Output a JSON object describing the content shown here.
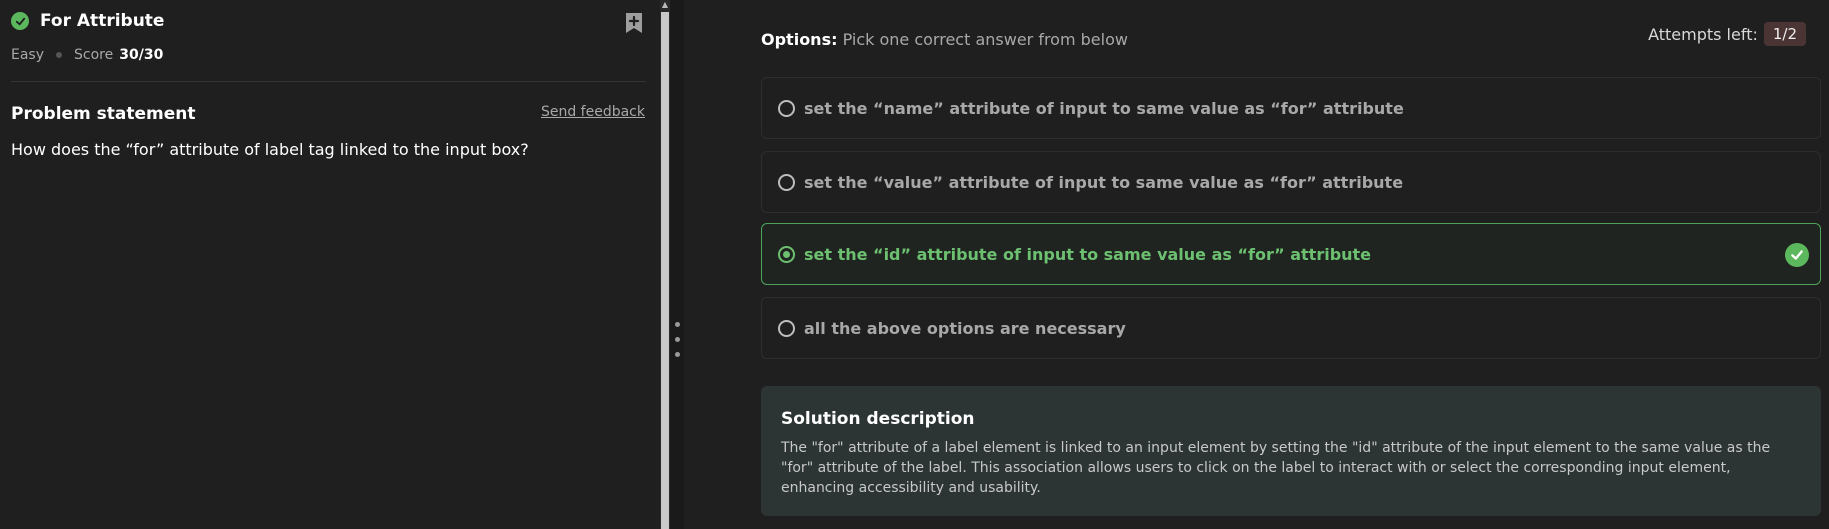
{
  "problem": {
    "title": "For Attribute",
    "difficulty": "Easy",
    "score_label": "Score",
    "score_value": "30/30",
    "statement_heading": "Problem statement",
    "feedback_link": "Send feedback",
    "question": "How does the “for” attribute of label tag linked to the input box?"
  },
  "options_section": {
    "label_bold": "Options:",
    "label_rest": " Pick one correct answer from below",
    "attempts_label": "Attempts left:",
    "attempts_value": "1/2",
    "items": [
      {
        "text": "set the “name” attribute of input to same value as “for” attribute",
        "selected": false,
        "correct": false
      },
      {
        "text": "set the “value” attribute of input to same value as “for” attribute",
        "selected": false,
        "correct": false
      },
      {
        "text": "set the “id” attribute of input to same value as “for” attribute",
        "selected": true,
        "correct": true
      },
      {
        "text": "all the above options are necessary",
        "selected": false,
        "correct": false
      }
    ]
  },
  "solution": {
    "heading": "Solution description",
    "body": "The \"for\" attribute of a label element is linked to an input element by setting the \"id\" attribute of the input element to the same value as the \"for\" attribute of the label. This association allows users to click on the label to interact with or select the corresponding input element, enhancing accessibility and usability."
  },
  "colors": {
    "accent_green": "#5cb85c",
    "correct_text": "#6cc070",
    "solution_bg": "#2c3434"
  }
}
